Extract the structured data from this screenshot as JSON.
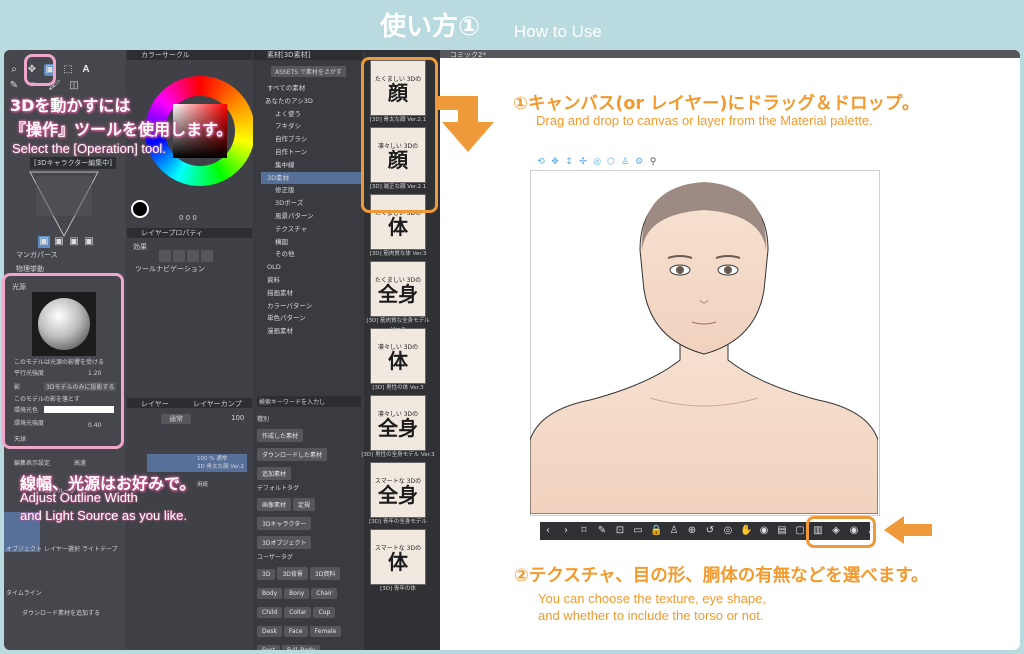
{
  "header": {
    "title": "使い方①",
    "subtitle": "How to Use"
  },
  "colors": {
    "accent_orange": "#ef9a3a",
    "accent_pink": "#f0a6c9",
    "bg": "#b9dbe0"
  },
  "tools": {
    "char_a": "A",
    "tool_group_label": "ツールグループ",
    "object_tab": "オブジェクト",
    "layer_select_tab": "レイヤー選択",
    "light_table_tab": "ライトテーブ",
    "timeline": "タイムライン",
    "add_download": "ダウンロード素材を追加する",
    "char_3d_panel": "[3Dキャラクター編集中]",
    "manga_perspective": "マンガパース",
    "physics": "物理挙動",
    "light_source": "光源",
    "affect_light": "このモデルは光源の影響を受ける",
    "parallel_light": "平行光強度",
    "parallel_value": "1.20",
    "shadow": "影",
    "shadow_target": "3Dモデルのみに投影する",
    "cast_shadow": "このモデルの影を落とす",
    "ambient_color": "環境光色",
    "ambient_strength": "環境光強度",
    "ambient_value": "0.40",
    "sky": "天球",
    "display_settings": "編集表示設定",
    "display_value": "高速"
  },
  "color_panel": {
    "title": "カラーサークル",
    "value": "0 0 0"
  },
  "layer_prop": {
    "title": "レイヤープロパティ",
    "effect": "効果",
    "tool_nav": "ツールナビゲーション"
  },
  "layer_panel": {
    "tab1": "レイヤー",
    "tab2": "レイヤーカンプ",
    "blend": "通常",
    "opacity": "100",
    "layer_name_top": "100 % 通常",
    "layer_name_bottom": "3D 骨太な顔 Ver.2",
    "paper": "用紙"
  },
  "material": {
    "title": "素材[3D素材]",
    "assets_btn": "ASSETS で素材をさがす",
    "tree": [
      "すべての素材",
      "あなたのアシ3D",
      "よく使う",
      "フキダシ",
      "自作ブラシ",
      "自作トーン",
      "集中線",
      "3D素材",
      "修正版",
      "3Dポーズ",
      "風景パターン",
      "テクスチャ",
      "構図",
      "その他",
      "OLD",
      "資料",
      "描画素材",
      "カラーパターン",
      "単色パターン",
      "漫画素材"
    ],
    "search_placeholder": "検索キーワードを入力し",
    "tags_title": "種別",
    "tags_a": [
      "作成した素材",
      "ダウンロードした素材",
      "追加素材"
    ],
    "default_tags_title": "デフォルトタグ",
    "tags_b": [
      "画像素材",
      "定規",
      "3Dキャラクター",
      "3Dオブジェクト"
    ],
    "user_tags_title": "ユーザータグ",
    "tags_c": [
      "3D",
      "3D背景",
      "3D資料",
      "Body",
      "Bony",
      "Chair",
      "Child",
      "Collar",
      "Cup",
      "Desk",
      "Face",
      "Female",
      "Foot",
      "Full_Body",
      "Glamorous",
      "Hair"
    ]
  },
  "thumbs": [
    {
      "top": "たくましい 3Dの",
      "big": "顔",
      "label": "[3D] 骨太な顔 Ver.2.1"
    },
    {
      "top": "凛々しい 3Dの",
      "big": "顔",
      "label": "[3D] 端正な顔 Ver.2.1"
    },
    {
      "top": "たくましい 3Dの",
      "big": "体",
      "label": "[3D] 筋肉質な体 Ver.3"
    },
    {
      "top": "たくましい 3Dの",
      "big": "全身",
      "label": "[3D] 筋肉質な全身モデル Ver.3"
    },
    {
      "top": "凛々しい 3Dの",
      "big": "体",
      "label": "[3D] 男性の体 Ver.3"
    },
    {
      "top": "凛々しい 3Dの",
      "big": "全身",
      "label": "[3D] 男性の全身モデル Ver.3"
    },
    {
      "top": "スマートな 3Dの",
      "big": "全身",
      "label": "[3D] 青年の全身モデル"
    },
    {
      "top": "スマートな 3Dの",
      "big": "体",
      "label": "[3D] 青年の体"
    }
  ],
  "canvas": {
    "tab": "コミック2*"
  },
  "annotations": {
    "step1_title": "①キャンバス(or レイヤー)にドラッグ＆ドロップ。",
    "step1_sub": "Drag and drop to canvas or layer from the Material palette.",
    "step2_title": "②テクスチャ、目の形、胴体の有無などを選べます。",
    "step2_sub_1": "You can choose the texture, eye shape,",
    "step2_sub_2": "and whether to include the torso or not.",
    "op_title_1": "3Dを動かすには",
    "op_title_2": "『操作』ツールを使用します。",
    "op_sub": "Select the [Operation] tool.",
    "light_title": "線幅、光源はお好みで。",
    "light_sub_1": "Adjust Outline Width",
    "light_sub_2": "and Light Source as you like."
  }
}
